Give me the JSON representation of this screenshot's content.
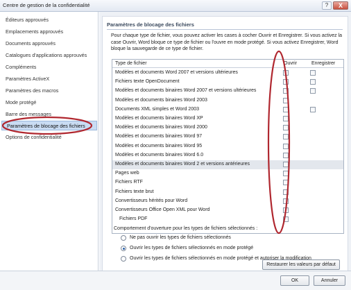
{
  "window": {
    "title": "Centre de gestion de la confidentialité",
    "help_label": "?",
    "close_label": "X"
  },
  "sidebar": {
    "items": [
      {
        "label": "Éditeurs approuvés"
      },
      {
        "label": "Emplacements approuvés"
      },
      {
        "label": "Documents approuvés"
      },
      {
        "label": "Catalogues d'applications approuvés"
      },
      {
        "label": "Compléments"
      },
      {
        "label": "Paramètres ActiveX"
      },
      {
        "label": "Paramètres des macros"
      },
      {
        "label": "Mode protégé"
      },
      {
        "label": "Barre des messages"
      },
      {
        "label": "Paramètres de blocage des fichiers"
      },
      {
        "label": "Options de confidentialité"
      }
    ],
    "active_index": 9
  },
  "main": {
    "section_title": "Paramètres de blocage des fichiers",
    "intro": "Pour chaque type de fichier, vous pouvez activer les cases à cocher Ouvrir et Enregistrer. Si vous activez la case Ouvrir, Word bloque ce type de fichier ou l'ouvre en mode protégé. Si vous activez Enregistrer, Word bloque la sauvegarde de ce type de fichier.",
    "table": {
      "headers": {
        "type": "Type de fichier",
        "open": "Ouvrir",
        "save": "Enregistrer"
      },
      "rows": [
        {
          "name": "Modèles et documents Word 2007 et versions ultérieures",
          "open": false,
          "save": false,
          "has_save": true
        },
        {
          "name": "Fichiers texte OpenDocument",
          "open": false,
          "save": false,
          "has_save": true
        },
        {
          "name": "Modèles et documents binaires Word 2007 et versions ultérieures",
          "open": false,
          "save": false,
          "has_save": true
        },
        {
          "name": "Modèles et documents binaires Word 2003",
          "open": false,
          "save": false,
          "has_save": false
        },
        {
          "name": "Documents XML simples et Word 2003",
          "open": false,
          "save": false,
          "has_save": true
        },
        {
          "name": "Modèles et documents binaires Word XP",
          "open": false,
          "save": false,
          "has_save": false
        },
        {
          "name": "Modèles et documents binaires Word 2000",
          "open": false,
          "save": false,
          "has_save": false
        },
        {
          "name": "Modèles et documents binaires Word 97",
          "open": false,
          "save": false,
          "has_save": false
        },
        {
          "name": "Modèles et documents binaires Word 95",
          "open": false,
          "save": false,
          "has_save": false
        },
        {
          "name": "Modèles et documents binaires Word 6.0",
          "open": false,
          "save": false,
          "has_save": false
        },
        {
          "name": "Modèles et documents binaires Word 2 et versions antérieures",
          "open": false,
          "save": false,
          "has_save": false,
          "selected": true
        },
        {
          "name": "Pages web",
          "open": false,
          "save": false,
          "has_save": false
        },
        {
          "name": "Fichiers RTF",
          "open": false,
          "save": false,
          "has_save": false
        },
        {
          "name": "Fichiers texte brut",
          "open": false,
          "save": false,
          "has_save": false
        },
        {
          "name": "Convertisseurs hérités pour Word",
          "open": false,
          "save": false,
          "has_save": false
        },
        {
          "name": "Convertisseurs Office Open XML pour Word",
          "open": false,
          "save": false,
          "has_save": false
        },
        {
          "name": "Fichiers PDF",
          "open": false,
          "save": false,
          "has_save": false
        }
      ]
    },
    "behavior_label": "Comportement d'ouverture pour les types de fichiers sélectionnés :",
    "radio_options": [
      {
        "label": "Ne pas ouvrir les types de fichiers sélectionnés",
        "checked": false
      },
      {
        "label": "Ouvrir les types de fichiers sélectionnés en mode protégé",
        "checked": true
      },
      {
        "label": "Ouvrir les types de fichiers sélectionnés en mode protégé et autoriser la modification",
        "checked": false
      }
    ],
    "restore_button": "Restaurer les valeurs par défaut"
  },
  "footer": {
    "ok_label": "OK",
    "cancel_label": "Annuler"
  },
  "colors": {
    "annotation_red": "#b0272f",
    "selected_sidebar": "#c9dcf3"
  }
}
